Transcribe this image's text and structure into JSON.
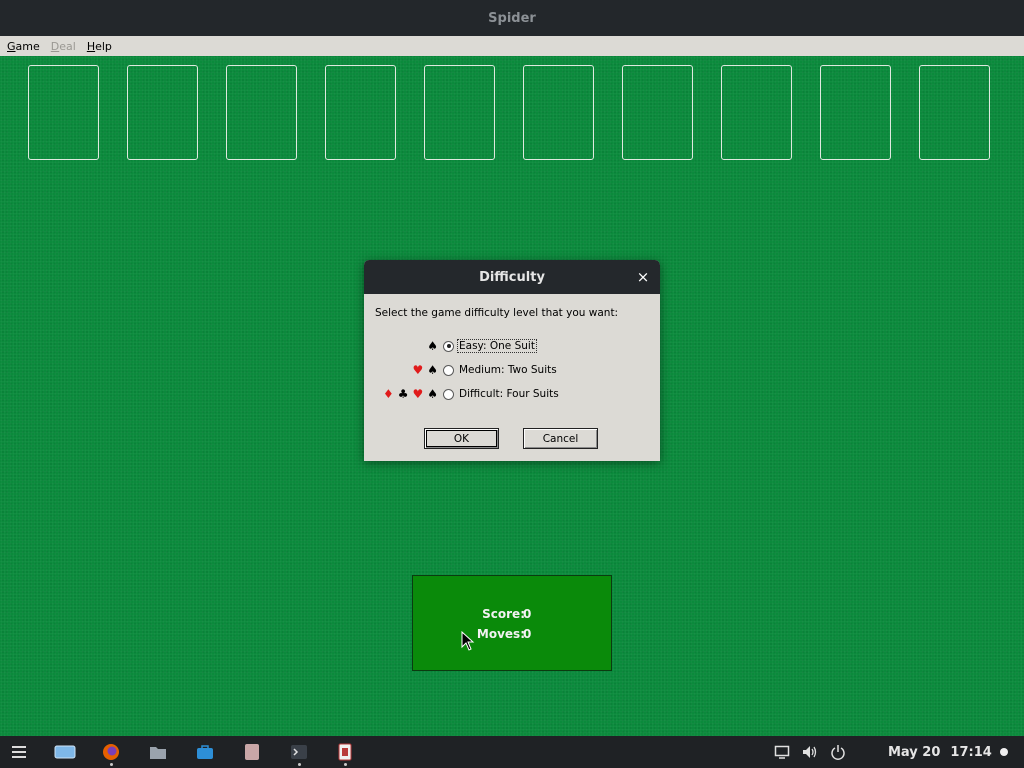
{
  "window": {
    "title": "Spider"
  },
  "menu": [
    {
      "label": "Game",
      "enabled": true
    },
    {
      "label": "Deal",
      "enabled": false
    },
    {
      "label": "Help",
      "enabled": true
    }
  ],
  "tableau_slot_count": 10,
  "dialog": {
    "title": "Difficulty",
    "close_glyph": "×",
    "prompt": "Select the game difficulty level that you want:",
    "options": [
      {
        "label": "Easy: One Suit",
        "suits": [
          "spade"
        ],
        "selected": true
      },
      {
        "label": "Medium: Two Suits",
        "suits": [
          "heart",
          "spade"
        ],
        "selected": false
      },
      {
        "label": "Difficult: Four Suits",
        "suits": [
          "diamond",
          "club",
          "heart",
          "spade"
        ],
        "selected": false
      }
    ],
    "ok_label": "OK",
    "cancel_label": "Cancel"
  },
  "score": {
    "score_label": "Score:",
    "score_value": "0",
    "moves_label": "Moves:",
    "moves_value": "0"
  },
  "taskbar": {
    "apps": [
      "zorin-menu-icon",
      "workspace-icon",
      "firefox-icon",
      "files-icon",
      "software-store-icon",
      "text-editor-icon",
      "terminal-icon",
      "spider-game-icon"
    ],
    "tray": [
      "screen-icon",
      "volume-icon",
      "power-icon"
    ],
    "date": "May 20",
    "time": "17:14"
  },
  "colors": {
    "felt": "#0b8a3c",
    "score_bg": "#0a8a0a",
    "red_suit": "#e01b1b",
    "dialog_bg": "#dcdad5",
    "titlebar": "#23272b"
  }
}
